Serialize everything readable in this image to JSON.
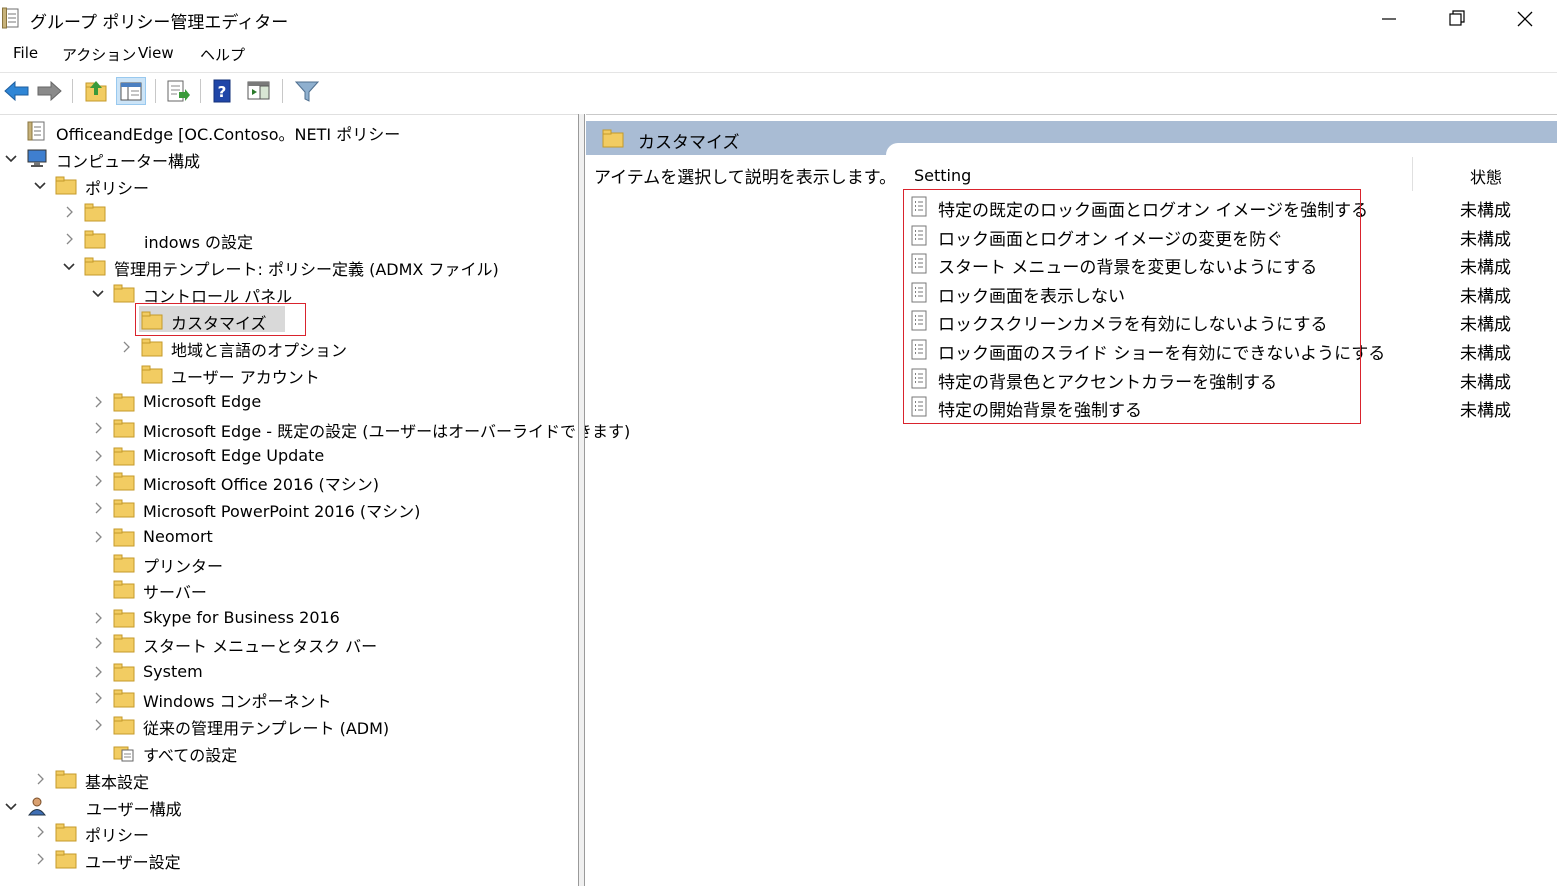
{
  "window": {
    "title": "グループ ポリシー管理エディター"
  },
  "menu": [
    "File",
    "アクション",
    "View",
    "ヘルプ"
  ],
  "tree": [
    {
      "label": "OfficeandEdge [OC.Contoso。NETI ポリシー",
      "depth": 0,
      "arrow": "none",
      "icon": "policy"
    },
    {
      "label": "コンピューター構成",
      "depth": 0,
      "arrow": "down",
      "icon": "computer"
    },
    {
      "label": "ポリシー",
      "depth": 1,
      "arrow": "down",
      "icon": "folder"
    },
    {
      "label": "",
      "depth": 2,
      "arrow": "right",
      "icon": "folder"
    },
    {
      "label": "indows の設定",
      "depth": 2,
      "arrow": "right",
      "icon": "folder"
    },
    {
      "label": "管理用テンプレート: ポリシー定義 (ADMX ファイル)",
      "depth": 2,
      "arrow": "down",
      "icon": "folder"
    },
    {
      "label": "コントロール パネル",
      "depth": 3,
      "arrow": "down",
      "icon": "folder"
    },
    {
      "label": "カスタマイズ",
      "depth": 4,
      "arrow": "none",
      "icon": "folder",
      "selected": true
    },
    {
      "label": "地域と言語のオプション",
      "depth": 4,
      "arrow": "right",
      "icon": "folder"
    },
    {
      "label": "ユーザー アカウント",
      "depth": 4,
      "arrow": "none",
      "icon": "folder"
    },
    {
      "label": "Microsoft Edge",
      "depth": 3,
      "arrow": "right",
      "icon": "folder"
    },
    {
      "label": "Microsoft Edge - 既定の設定 (ユーザーはオーバーライドできます)",
      "depth": 3,
      "arrow": "right",
      "icon": "folder"
    },
    {
      "label": "Microsoft Edge Update",
      "depth": 3,
      "arrow": "right",
      "icon": "folder"
    },
    {
      "label": "Microsoft Office 2016 (マシン)",
      "depth": 3,
      "arrow": "right",
      "icon": "folder"
    },
    {
      "label": "Microsoft PowerPoint 2016 (マシン)",
      "depth": 3,
      "arrow": "right",
      "icon": "folder"
    },
    {
      "label": "Neomort",
      "depth": 3,
      "arrow": "right",
      "icon": "folder"
    },
    {
      "label": "プリンター",
      "depth": 3,
      "arrow": "none",
      "icon": "folder"
    },
    {
      "label": "サーバー",
      "depth": 3,
      "arrow": "none",
      "icon": "folder"
    },
    {
      "label": "Skype for Business 2016",
      "depth": 3,
      "arrow": "right",
      "icon": "folder"
    },
    {
      "label": "スタート メニューとタスク バー",
      "depth": 3,
      "arrow": "right",
      "icon": "folder"
    },
    {
      "label": "System",
      "depth": 3,
      "arrow": "right",
      "icon": "folder"
    },
    {
      "label": "Windows コンポーネント",
      "depth": 3,
      "arrow": "right",
      "icon": "folder"
    },
    {
      "label": "従来の管理用テンプレート (ADM)",
      "depth": 3,
      "arrow": "right",
      "icon": "folder"
    },
    {
      "label": "すべての設定",
      "depth": 3,
      "arrow": "none",
      "icon": "allsettings"
    },
    {
      "label": "基本設定",
      "depth": 1,
      "arrow": "right",
      "icon": "folder"
    },
    {
      "label": "ユーザー構成",
      "depth": 0,
      "arrow": "down",
      "icon": "user"
    },
    {
      "label": "ポリシー",
      "depth": 1,
      "arrow": "right",
      "icon": "folder"
    },
    {
      "label": "ユーザー設定",
      "depth": 1,
      "arrow": "right",
      "icon": "folder"
    }
  ],
  "right": {
    "header": "カスタマイズ",
    "description": "アイテムを選択して説明を表示します。",
    "col_setting": "Setting",
    "col_state": "状態",
    "settings": [
      {
        "label": "特定の既定のロック画面とログオン イメージを強制する",
        "state": "未構成"
      },
      {
        "label": "ロック画面とログオン イメージの変更を防ぐ",
        "state": "未構成"
      },
      {
        "label": "スタート メニューの背景を変更しないようにする",
        "state": "未構成"
      },
      {
        "label": "ロック画面を表示しない",
        "state": "未構成"
      },
      {
        "label": "ロックスクリーンカメラを有効にしないようにする",
        "state": "未構成"
      },
      {
        "label": "ロック画面のスライド ショーを有効にできないようにする",
        "state": "未構成"
      },
      {
        "label": "特定の背景色とアクセントカラーを強制する",
        "state": "未構成"
      },
      {
        "label": "特定の開始背景を強制する",
        "state": "未構成"
      }
    ]
  },
  "colors": {
    "header_band": "#a9bcd4",
    "highlight": "#d9232d",
    "folder": "#f2cc62"
  }
}
